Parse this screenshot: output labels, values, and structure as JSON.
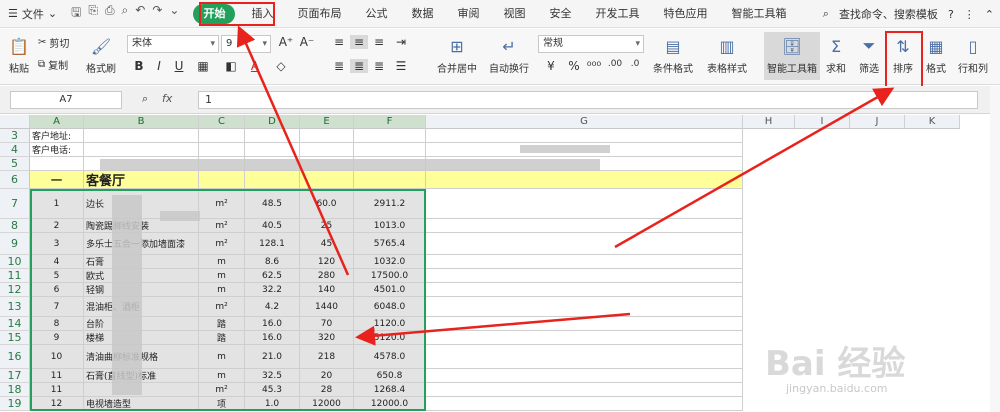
{
  "menubar": {
    "file_label": "文件",
    "tabs": [
      "开始",
      "插入",
      "页面布局",
      "公式",
      "数据",
      "审阅",
      "视图",
      "安全",
      "开发工具",
      "特色应用",
      "智能工具箱"
    ],
    "search_label": "查找命令、搜索模板",
    "help": "?"
  },
  "ribbon": {
    "paste": "粘贴",
    "cut": "剪切",
    "copy": "复制",
    "format_painter": "格式刷",
    "font_name": "宋体",
    "font_size": "9",
    "merge_center": "合并居中",
    "wrap_text": "自动换行",
    "number_format": "常规",
    "conditional_format": "条件格式",
    "table_style": "表格样式",
    "smart_toolbox": "智能工具箱",
    "sum": "求和",
    "filter": "筛选",
    "sort": "排序",
    "format": "格式",
    "row_col": "行和列"
  },
  "formula_bar": {
    "cell_ref": "A7",
    "fx_label": "fx",
    "value": "1"
  },
  "columns": [
    "A",
    "B",
    "C",
    "D",
    "E",
    "F",
    "G",
    "H",
    "I",
    "J",
    "K"
  ],
  "rows": [
    {
      "num": "3",
      "a": "客户地址:",
      "b": "",
      "c": "",
      "d": "",
      "e": "",
      "f": ""
    },
    {
      "num": "4",
      "a": "客户电话:",
      "b": "",
      "c": "",
      "d": "",
      "e": "",
      "f": ""
    },
    {
      "num": "5",
      "a": "",
      "b": "",
      "c": "",
      "d": "",
      "e": "",
      "f": ""
    },
    {
      "num": "6",
      "a": "一",
      "b": "客餐厅",
      "c": "",
      "d": "",
      "e": "",
      "f": ""
    },
    {
      "num": "7",
      "a": "1",
      "b": "边长",
      "c": "m²",
      "d": "48.5",
      "e": "60.0",
      "f": "2911.2"
    },
    {
      "num": "8",
      "a": "2",
      "b": "陶瓷踢脚线安装",
      "c": "m²",
      "d": "40.5",
      "e": "25",
      "f": "1013.0"
    },
    {
      "num": "9",
      "a": "3",
      "b": "多乐士五合一添加墙面漆",
      "c": "m²",
      "d": "128.1",
      "e": "45",
      "f": "5765.4"
    },
    {
      "num": "10",
      "a": "4",
      "b": "石膏",
      "c": "m",
      "d": "8.6",
      "e": "120",
      "f": "1032.0"
    },
    {
      "num": "11",
      "a": "5",
      "b": "欧式",
      "c": "m",
      "d": "62.5",
      "e": "280",
      "f": "17500.0"
    },
    {
      "num": "12",
      "a": "6",
      "b": "轻钢",
      "c": "m",
      "d": "32.2",
      "e": "140",
      "f": "4501.0"
    },
    {
      "num": "13",
      "a": "7",
      "b": "混油柜、酒柜",
      "c": "m²",
      "d": "4.2",
      "e": "1440",
      "f": "6048.0"
    },
    {
      "num": "14",
      "a": "8",
      "b": "台阶",
      "c": "踏",
      "d": "16.0",
      "e": "70",
      "f": "1120.0"
    },
    {
      "num": "15",
      "a": "9",
      "b": "楼梯",
      "c": "踏",
      "d": "16.0",
      "e": "320",
      "f": "5120.0"
    },
    {
      "num": "16",
      "a": "10",
      "b": "清油曲柳标准规格",
      "c": "m",
      "d": "21.0",
      "e": "218",
      "f": "4578.0"
    },
    {
      "num": "17",
      "a": "11",
      "b": "石膏(直线型)标准",
      "c": "m",
      "d": "32.5",
      "e": "20",
      "f": "650.8"
    },
    {
      "num": "18",
      "a": "11",
      "b": "",
      "c": "m²",
      "d": "45.3",
      "e": "28",
      "f": "1268.4"
    },
    {
      "num": "19",
      "a": "12",
      "b": "电视墙造型",
      "c": "项",
      "d": "1.0",
      "e": "12000",
      "f": "12000.0"
    }
  ],
  "watermark": {
    "brand": "Bai 经验",
    "url": "jingyan.baidu.com"
  },
  "colors": {
    "accent": "#23a15c",
    "highlight": "#e8231d",
    "header_fill": "#ffff99",
    "row_num": "#2a7a46"
  }
}
